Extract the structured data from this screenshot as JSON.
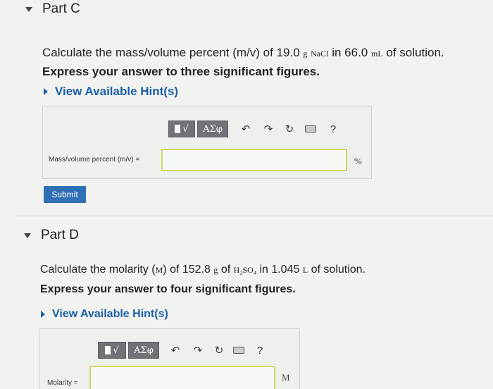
{
  "partC": {
    "title": "Part C",
    "question": {
      "before": "Calculate the mass/volume percent (m/v) of 19.0",
      "unit1": "g",
      "compound": "NaCl",
      "mid": "in 66.0",
      "unit2": "mL",
      "after": "of solution."
    },
    "express": "Express your answer to three significant figures.",
    "hint_label": "View Available Hint(s)",
    "toolbar": {
      "template_label": "√",
      "greek_label": "ΑΣφ",
      "help_label": "?"
    },
    "field_label": "Mass/volume percent (m/v) =",
    "input_value": "",
    "unit": "%",
    "submit_label": "Submit"
  },
  "partD": {
    "title": "Part D",
    "question": {
      "before": "Calculate the molarity (",
      "unit_m": "M",
      "mid1": ") of 152.8",
      "unit_g": "g",
      "mid2": "of",
      "compound": "H₂SO₄",
      "mid3": "in 1.045",
      "unit_l": "L",
      "after": "of solution."
    },
    "express": "Express your answer to four significant figures.",
    "hint_label": "View Available Hint(s)",
    "toolbar": {
      "template_label": "√",
      "greek_label": "ΑΣφ",
      "help_label": "?"
    },
    "field_label": "Molarity =",
    "input_value": "",
    "unit": "M"
  },
  "colors": {
    "link": "#1c5fa8",
    "submit": "#2f6fb5",
    "toolbar_button": "#6f7378",
    "input_border": "#d4d86b"
  }
}
